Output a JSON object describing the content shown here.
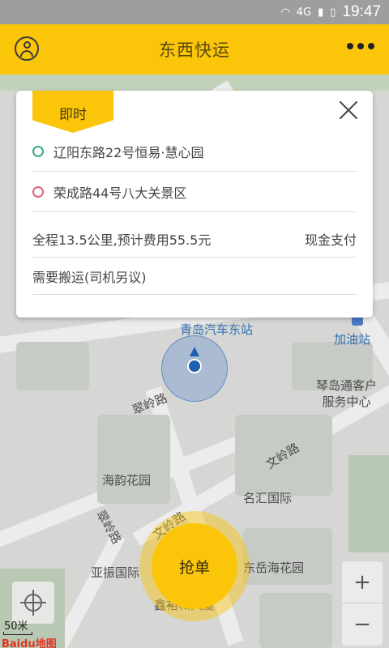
{
  "status_bar": {
    "network": "4G",
    "time": "19:47"
  },
  "header": {
    "title": "东西快运"
  },
  "order_card": {
    "tag": "即时",
    "origin": "辽阳东路22号恒易·慧心园",
    "destination": "荣成路44号八大关景区",
    "summary": "全程13.5公里,预计费用55.5元",
    "payment": "现金支付",
    "note": "需要搬运(司机另议)"
  },
  "map": {
    "labels": {
      "station": "青岛汽车东站",
      "gas": "加油站",
      "center": "琴岛通客户\n服务中心",
      "road1": "翠岭路",
      "road2": "文岭路",
      "park": "海韵花园",
      "plaza": "名汇国际",
      "road3": "翠岭路",
      "road4": "文岭路",
      "yazhen": "亚振国际",
      "dongyue": "东岳海花园",
      "xinyu": "鑫裕和大厦"
    },
    "scale": "50米",
    "provider": "Baidu地图"
  },
  "grab_button": {
    "label": "抢单"
  },
  "zoom": {
    "plus": "+",
    "minus": "−"
  },
  "colors": {
    "brand": "#fbc50a",
    "origin_dot": "#3aa98a",
    "dest_dot": "#e2627b"
  }
}
